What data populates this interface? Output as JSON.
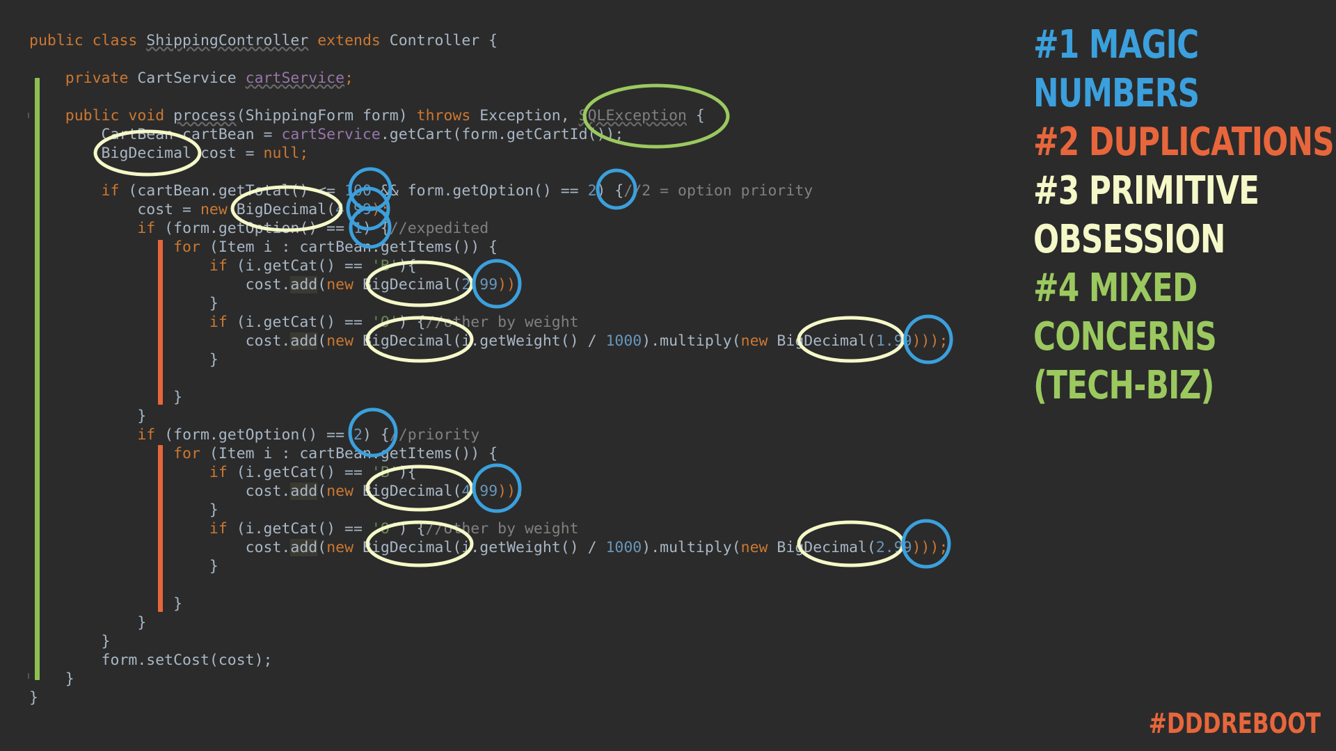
{
  "code": {
    "lines": [
      [
        {
          "t": "public class ",
          "c": "kw"
        },
        {
          "t": "ShippingController",
          "c": "und"
        },
        {
          "t": " ",
          "c": "plain"
        },
        {
          "t": "extends",
          "c": "kw"
        },
        {
          "t": " Controller {",
          "c": "plain"
        }
      ],
      [],
      [
        {
          "t": "    ",
          "c": "plain"
        },
        {
          "t": "private",
          "c": "kw"
        },
        {
          "t": " CartService ",
          "c": "plain"
        },
        {
          "t": "cartService",
          "c": "und-field"
        },
        {
          "t": ";",
          "c": "kw"
        }
      ],
      [],
      [
        {
          "t": "    ",
          "c": "plain"
        },
        {
          "t": "public void ",
          "c": "kw"
        },
        {
          "t": "process",
          "c": "und"
        },
        {
          "t": "(ShippingForm form) ",
          "c": "plain"
        },
        {
          "t": "throws",
          "c": "kw"
        },
        {
          "t": " Exception, ",
          "c": "plain"
        },
        {
          "t": "SQLException",
          "c": "muted"
        },
        {
          "t": " {",
          "c": "plain"
        }
      ],
      [
        {
          "t": "        CartBean cartBean = ",
          "c": "plain"
        },
        {
          "t": "cartService",
          "c": "field"
        },
        {
          "t": ".getCart(form.getCartId());",
          "c": "plain"
        }
      ],
      [
        {
          "t": "        BigDecimal cost = ",
          "c": "plain"
        },
        {
          "t": "null",
          "c": "kw"
        },
        {
          "t": ";",
          "c": "kw"
        }
      ],
      [],
      [
        {
          "t": "        ",
          "c": "plain"
        },
        {
          "t": "if",
          "c": "kw"
        },
        {
          "t": " (cartBean.getTotal() <= ",
          "c": "plain"
        },
        {
          "t": "100",
          "c": "num"
        },
        {
          "t": " && form.getOption() == ",
          "c": "plain"
        },
        {
          "t": "2",
          "c": "num"
        },
        {
          "t": ") {",
          "c": "plain"
        },
        {
          "t": "//2 = option priority",
          "c": "com"
        }
      ],
      [
        {
          "t": "            cost = ",
          "c": "plain"
        },
        {
          "t": "new",
          "c": "kw"
        },
        {
          "t": " BigDecimal(",
          "c": "plain"
        },
        {
          "t": "4.99",
          "c": "num"
        },
        {
          "t": ");",
          "c": "kw"
        }
      ],
      [
        {
          "t": "            ",
          "c": "plain"
        },
        {
          "t": "if",
          "c": "kw"
        },
        {
          "t": " (form.getOption() == ",
          "c": "plain"
        },
        {
          "t": "1",
          "c": "num"
        },
        {
          "t": ") {",
          "c": "plain"
        },
        {
          "t": "//expedited",
          "c": "com"
        }
      ],
      [
        {
          "t": "                ",
          "c": "plain"
        },
        {
          "t": "for",
          "c": "kw"
        },
        {
          "t": " (Item i : cartBean.getItems()) {",
          "c": "plain"
        }
      ],
      [
        {
          "t": "                    ",
          "c": "plain"
        },
        {
          "t": "if",
          "c": "kw"
        },
        {
          "t": " (i.getCat() == ",
          "c": "plain"
        },
        {
          "t": "'B'",
          "c": "str"
        },
        {
          "t": "){",
          "c": "plain"
        }
      ],
      [
        {
          "t": "                        cost.",
          "c": "plain"
        },
        {
          "t": "add",
          "c": "hl"
        },
        {
          "t": "(",
          "c": "plain"
        },
        {
          "t": "new",
          "c": "kw"
        },
        {
          "t": " BigDecimal(",
          "c": "plain"
        },
        {
          "t": "2.99",
          "c": "num"
        },
        {
          "t": "));",
          "c": "kw"
        }
      ],
      [
        {
          "t": "                    }",
          "c": "plain"
        }
      ],
      [
        {
          "t": "                    ",
          "c": "plain"
        },
        {
          "t": "if",
          "c": "kw"
        },
        {
          "t": " (i.getCat() == ",
          "c": "plain"
        },
        {
          "t": "'O'",
          "c": "str"
        },
        {
          "t": ") {",
          "c": "plain"
        },
        {
          "t": "//other by weight",
          "c": "com"
        }
      ],
      [
        {
          "t": "                        cost.",
          "c": "plain"
        },
        {
          "t": "add",
          "c": "hl"
        },
        {
          "t": "(",
          "c": "plain"
        },
        {
          "t": "new",
          "c": "kw"
        },
        {
          "t": " BigDecimal(i.getWeight() / ",
          "c": "plain"
        },
        {
          "t": "1000",
          "c": "num"
        },
        {
          "t": ").multiply(",
          "c": "plain"
        },
        {
          "t": "new",
          "c": "kw"
        },
        {
          "t": " BigDecimal(",
          "c": "plain"
        },
        {
          "t": "1.99",
          "c": "num"
        },
        {
          "t": ")));",
          "c": "kw"
        }
      ],
      [
        {
          "t": "                    }",
          "c": "plain"
        }
      ],
      [],
      [
        {
          "t": "                }",
          "c": "plain"
        }
      ],
      [
        {
          "t": "            }",
          "c": "plain"
        }
      ],
      [
        {
          "t": "            ",
          "c": "plain"
        },
        {
          "t": "if",
          "c": "kw"
        },
        {
          "t": " (form.getOption() == ",
          "c": "plain"
        },
        {
          "t": "2",
          "c": "num"
        },
        {
          "t": ") {",
          "c": "plain"
        },
        {
          "t": "//priority",
          "c": "com"
        }
      ],
      [
        {
          "t": "                ",
          "c": "plain"
        },
        {
          "t": "for",
          "c": "kw"
        },
        {
          "t": " (Item i : cartBean.getItems()) {",
          "c": "plain"
        }
      ],
      [
        {
          "t": "                    ",
          "c": "plain"
        },
        {
          "t": "if",
          "c": "kw"
        },
        {
          "t": " (i.getCat() == ",
          "c": "plain"
        },
        {
          "t": "'B'",
          "c": "str"
        },
        {
          "t": "){",
          "c": "plain"
        }
      ],
      [
        {
          "t": "                        cost.",
          "c": "plain"
        },
        {
          "t": "add",
          "c": "hl"
        },
        {
          "t": "(",
          "c": "plain"
        },
        {
          "t": "new",
          "c": "kw"
        },
        {
          "t": " BigDecimal(",
          "c": "plain"
        },
        {
          "t": "4.99",
          "c": "num"
        },
        {
          "t": "));",
          "c": "kw"
        }
      ],
      [
        {
          "t": "                    }",
          "c": "plain"
        }
      ],
      [
        {
          "t": "                    ",
          "c": "plain"
        },
        {
          "t": "if",
          "c": "kw"
        },
        {
          "t": " (i.getCat() == ",
          "c": "plain"
        },
        {
          "t": "'O'",
          "c": "str"
        },
        {
          "t": ") {",
          "c": "plain"
        },
        {
          "t": "//other by weight",
          "c": "com"
        }
      ],
      [
        {
          "t": "                        cost.",
          "c": "plain"
        },
        {
          "t": "add",
          "c": "hl"
        },
        {
          "t": "(",
          "c": "plain"
        },
        {
          "t": "new",
          "c": "kw"
        },
        {
          "t": " BigDecimal(i.getWeight() / ",
          "c": "plain"
        },
        {
          "t": "1000",
          "c": "num"
        },
        {
          "t": ").multiply(",
          "c": "plain"
        },
        {
          "t": "new",
          "c": "kw"
        },
        {
          "t": " BigDecimal(",
          "c": "plain"
        },
        {
          "t": "2.99",
          "c": "num"
        },
        {
          "t": ")));",
          "c": "kw"
        }
      ],
      [
        {
          "t": "                    }",
          "c": "plain"
        }
      ],
      [],
      [
        {
          "t": "                }",
          "c": "plain"
        }
      ],
      [
        {
          "t": "            }",
          "c": "plain"
        }
      ],
      [
        {
          "t": "        }",
          "c": "plain"
        }
      ],
      [
        {
          "t": "        form.setCost(cost);",
          "c": "plain"
        },
        {
          "t": "",
          "c": "kw"
        }
      ],
      [
        {
          "t": "    }",
          "c": "plain"
        }
      ],
      [
        {
          "t": "}",
          "c": "plain"
        }
      ]
    ]
  },
  "panel": {
    "item1_line1": "#1 MAGIC",
    "item1_line2": "NUMBERS",
    "item2_line1": "#2 DUPLICATIONS",
    "item3_line1": "#3 PRIMITIVE",
    "item3_line2": "OBSESSION",
    "item4_line1": "#4 MIXED",
    "item4_line2": "CONCERNS",
    "item4_line3": "(TECH-BIZ)"
  },
  "hashtag": "#DDDREBOOT",
  "colors": {
    "background": "#2b2b2b",
    "keyword": "#cc7832",
    "number": "#6897bb",
    "comment": "#808080",
    "magic_numbers_blue": "#3ba0dd",
    "duplications_orange": "#e8663c",
    "primitive_obsession_cream": "#f5f8c8",
    "mixed_concerns_green": "#9bc95f"
  }
}
